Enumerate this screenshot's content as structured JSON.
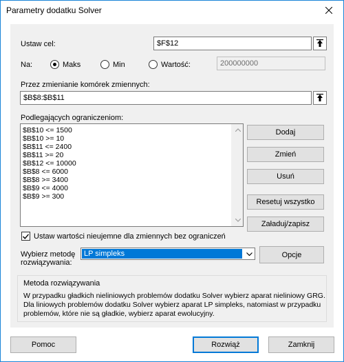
{
  "window": {
    "title": "Parametry dodatku Solver"
  },
  "objective": {
    "label": "Ustaw cel:",
    "value": "$F$12"
  },
  "to": {
    "label": "Na:",
    "options": [
      {
        "label": "Maks",
        "selected": true
      },
      {
        "label": "Min",
        "selected": false
      },
      {
        "label": "Wartość:",
        "selected": false
      }
    ],
    "value_field": "200000000"
  },
  "variables": {
    "label": "Przez zmienianie komórek zmiennych:",
    "value": "$B$8:$B$11"
  },
  "constraints": {
    "label": "Podlegających ograniczeniom:",
    "items": [
      "$B$10 <= 1500",
      "$B$10 >= 10",
      "$B$11 <= 2400",
      "$B$11 >= 20",
      "$B$12 <= 10000",
      "$B$8 <= 6000",
      "$B$8 >= 3400",
      "$B$9 <= 4000",
      "$B$9 >= 300"
    ],
    "buttons": {
      "add": "Dodaj",
      "change": "Zmień",
      "delete": "Usuń",
      "reset": "Resetuj wszystko",
      "load_save": "Załaduj/zapisz"
    }
  },
  "nonnegative": {
    "label": "Ustaw wartości nieujemne dla zmiennych bez ograniczeń",
    "checked": true
  },
  "method": {
    "label_line1": "Wybierz metodę",
    "label_line2": "rozwiązywania:",
    "selected": "LP simpleks",
    "options_button": "Opcje"
  },
  "method_description": {
    "title": "Metoda rozwiązywania",
    "lines": [
      "W przypadku gładkich nieliniowych problemów dodatku Solver wybierz aparat nieliniowy GRG.",
      "Dla liniowych problemów dodatku Solver wybierz aparat LP simpleks, natomiast w przypadku",
      "problemów, które nie są gładkie, wybierz aparat ewolucyjny."
    ]
  },
  "footer": {
    "help": "Pomoc",
    "solve": "Rozwiąż",
    "close": "Zamknij"
  },
  "colors": {
    "accent": "#0078d7",
    "panel": "#f0f0f0",
    "border": "#1883d7"
  },
  "icons": [
    "close-icon",
    "collapse-dialog-icon",
    "scroll-up-icon",
    "scroll-down-icon",
    "checkmark-icon",
    "chevron-down-icon"
  ]
}
